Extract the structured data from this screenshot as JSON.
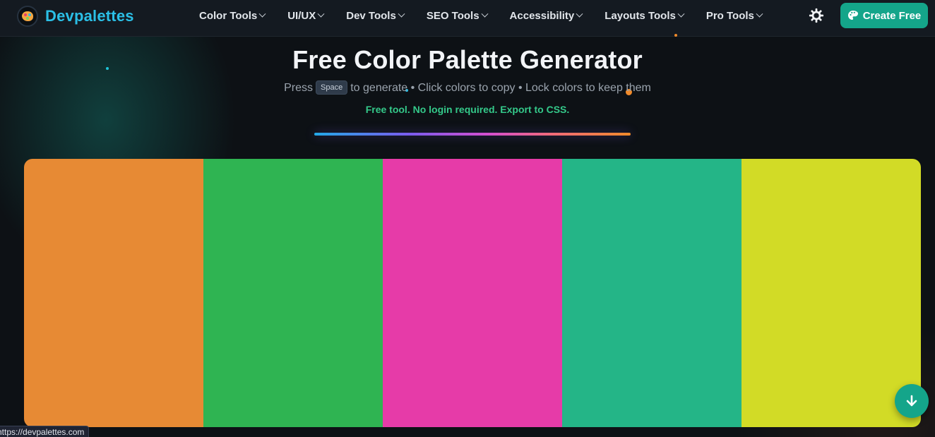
{
  "brand": {
    "name": "Devpalettes"
  },
  "nav": {
    "items": [
      {
        "label": "Color Tools"
      },
      {
        "label": "UI/UX"
      },
      {
        "label": "Dev Tools"
      },
      {
        "label": "SEO Tools"
      },
      {
        "label": "Accessibility"
      },
      {
        "label": "Layouts Tools"
      },
      {
        "label": "Pro Tools"
      }
    ],
    "cta_label": "Create Free",
    "theme_icon": "sun-gear-icon"
  },
  "hero": {
    "title": "Free Color Palette Generator",
    "sub_before": "Press",
    "kbd": "Space",
    "sub_after": "to generate • Click colors to copy • Lock colors to keep them",
    "note": "Free tool. No login required. Export to CSS."
  },
  "palette": {
    "colors": [
      "#E78A34",
      "#2FB452",
      "#E63BA8",
      "#24B587",
      "#D2DB26"
    ]
  },
  "status_url": "https://devpalettes.com",
  "theme": {
    "accent": "#14A58A",
    "brand_text": "#2BBFE6",
    "note_green": "#34C98A"
  }
}
